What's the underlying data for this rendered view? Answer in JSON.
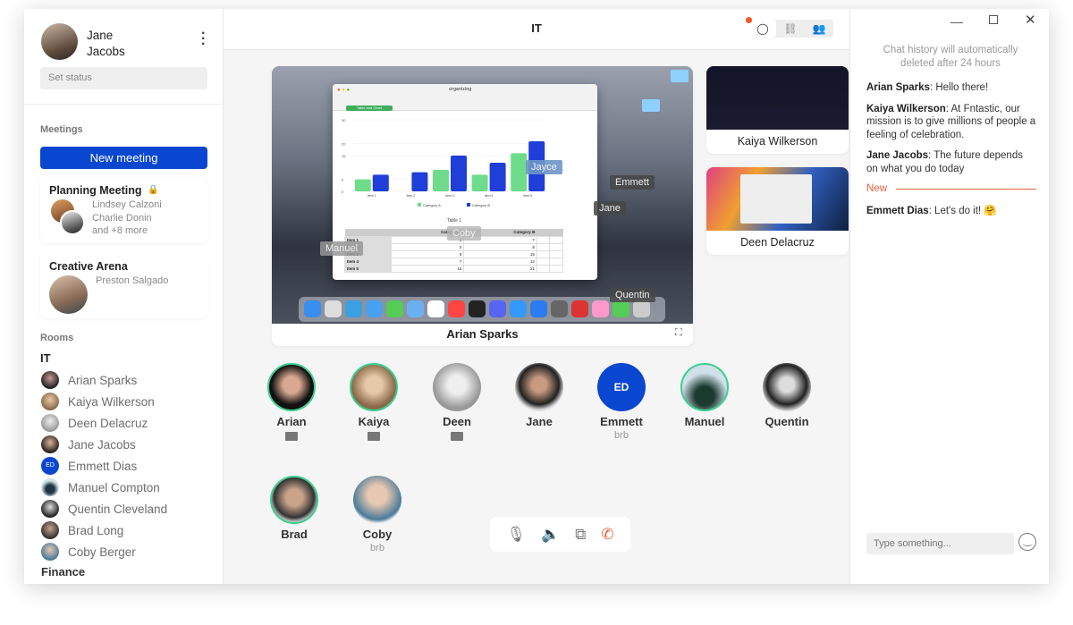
{
  "profile": {
    "first_name": "Jane",
    "last_name": "Jacobs",
    "status_placeholder": "Set status"
  },
  "sidebar": {
    "meetings_label": "Meetings",
    "new_meeting_label": "New meeting",
    "meetings": [
      {
        "title": "Planning Meeting",
        "locked": true,
        "members": [
          "Lindsey Calzoni",
          "Charlie Donin",
          "and +8 more"
        ]
      },
      {
        "title": "Creative Arena",
        "locked": false,
        "members": [
          "Preston Salgado"
        ]
      }
    ],
    "rooms_label": "Rooms",
    "room_name": "IT",
    "room_members": [
      "Arian Sparks",
      "Kaiya Wilkerson",
      "Deen Delacruz",
      "Jane Jacobs",
      "Emmett Dias",
      "Manuel Compton",
      "Quentin Cleveland",
      "Brad Long",
      "Coby  Berger"
    ],
    "next_room": "Finance"
  },
  "header": {
    "title": "IT",
    "has_unread": true
  },
  "shared_screen": {
    "presenter": "Arian Sparks",
    "app_title": "organizing",
    "sheet_tab": "Table and Chart",
    "table_title": "Table 1",
    "columns": [
      "",
      "Category A",
      "Category B"
    ],
    "rows": [
      [
        "Item 1",
        5,
        7
      ],
      [
        "Item 2",
        0,
        8
      ],
      [
        "Item 3",
        9,
        15
      ],
      [
        "Item 4",
        7,
        12
      ],
      [
        "Item 5",
        16,
        21
      ]
    ],
    "legend": [
      "Category A",
      "Category B"
    ],
    "y_ticks": [
      0,
      5,
      15,
      20,
      30
    ],
    "colors": {
      "category_a": "#6fdc8c",
      "category_b": "#1f3fd8"
    },
    "cursors": [
      "Jayce",
      "Emmett",
      "Jane",
      "Coby",
      "Manuel",
      "Quentin"
    ]
  },
  "thumbnails": [
    {
      "name": "Kaiya Wilkerson"
    },
    {
      "name": "Deen Delacruz"
    }
  ],
  "participants": [
    {
      "name": "Arian",
      "sharing": true,
      "speaking": true,
      "status": ""
    },
    {
      "name": "Kaiya",
      "sharing": true,
      "speaking": true,
      "status": ""
    },
    {
      "name": "Deen",
      "sharing": true,
      "speaking": false,
      "status": ""
    },
    {
      "name": "Jane",
      "sharing": false,
      "speaking": false,
      "status": ""
    },
    {
      "name": "Emmett",
      "initials": "ED",
      "sharing": false,
      "speaking": false,
      "status": "brb"
    },
    {
      "name": "Manuel",
      "sharing": false,
      "speaking": true,
      "status": ""
    },
    {
      "name": "Quentin",
      "sharing": false,
      "speaking": false,
      "status": ""
    },
    {
      "name": "Brad",
      "sharing": false,
      "speaking": true,
      "status": ""
    },
    {
      "name": "Coby",
      "sharing": false,
      "speaking": false,
      "status": "brb"
    }
  ],
  "chat": {
    "notice": "Chat history will automatically deleted after 24 hours",
    "messages": [
      {
        "author": "Arian Sparks",
        "text": ": Hello there!"
      },
      {
        "author": "Kaiya Wilkerson",
        "text": ": At Fntastic, our mission is to give millions of people a feeling of celebration."
      },
      {
        "author": "Jane Jacobs",
        "text": ": The future depends on what you do today"
      }
    ],
    "new_label": "New",
    "new_messages": [
      {
        "author": "Emmett Dias",
        "text": ": Let's do it! 🤗"
      }
    ],
    "input_placeholder": "Type something..."
  },
  "colors": {
    "accent": "#0a47d1",
    "speaking_ring": "#3ccf91",
    "new_divider": "#e8603c",
    "hangup": "#e8603c"
  }
}
